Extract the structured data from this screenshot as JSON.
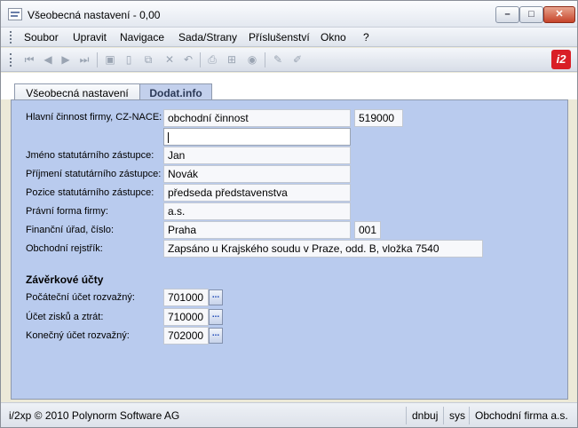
{
  "window": {
    "title": "Všeobecná nastavení - 0,00"
  },
  "menu": [
    "Soubor",
    "Upravit",
    "Navigace",
    "Sada/Strany",
    "Příslušenství",
    "Okno",
    "?"
  ],
  "toolbar": {
    "icons": [
      "first-record-icon",
      "previous-record-icon",
      "next-record-icon",
      "last-record-icon",
      "save-icon",
      "new-document-icon",
      "copy-icon",
      "delete-icon",
      "undo-icon",
      "print-icon",
      "tree-icon",
      "web-icon",
      "edit-icon",
      "edit-alt-icon"
    ],
    "logo_text": "i2"
  },
  "tabs": [
    {
      "label": "Všeobecná nastavení",
      "active": false
    },
    {
      "label": "Dodat.info",
      "active": true
    }
  ],
  "form": {
    "activity_label": "Hlavní činnost firmy, CZ-NACE:",
    "activity_value": "obchodní činnost",
    "activity_code": "519000",
    "activity_extra": "",
    "stat_name_label": "Jméno statutárního zástupce:",
    "stat_name_value": "Jan",
    "stat_surname_label": "Příjmení statutárního zástupce:",
    "stat_surname_value": "Novák",
    "stat_position_label": "Pozice statutárního zástupce:",
    "stat_position_value": "předseda představenstva",
    "legal_form_label": "Právní forma firmy:",
    "legal_form_value": "a.s.",
    "tax_office_label": "Finanční úřad, číslo:",
    "tax_office_value": "Praha",
    "tax_office_number": "001",
    "register_label": "Obchodní rejstřík:",
    "register_value": "Zapsáno u Krajského soudu v Praze, odd. B, vložka 7540"
  },
  "closing_accounts": {
    "title": "Závěrkové účty",
    "opening_label": "Počáteční účet rozvažný:",
    "opening_value": "701000",
    "profit_loss_label": "Účet zisků a ztrát:",
    "profit_loss_value": "710000",
    "closing_label": "Konečný účet rozvažný:",
    "closing_value": "702000",
    "browse_label": "..."
  },
  "status": {
    "copyright": "i/2xp © 2010 Polynorm Software AG",
    "user": "dnbuj",
    "db": "sys",
    "company": "Obchodní firma a.s."
  }
}
